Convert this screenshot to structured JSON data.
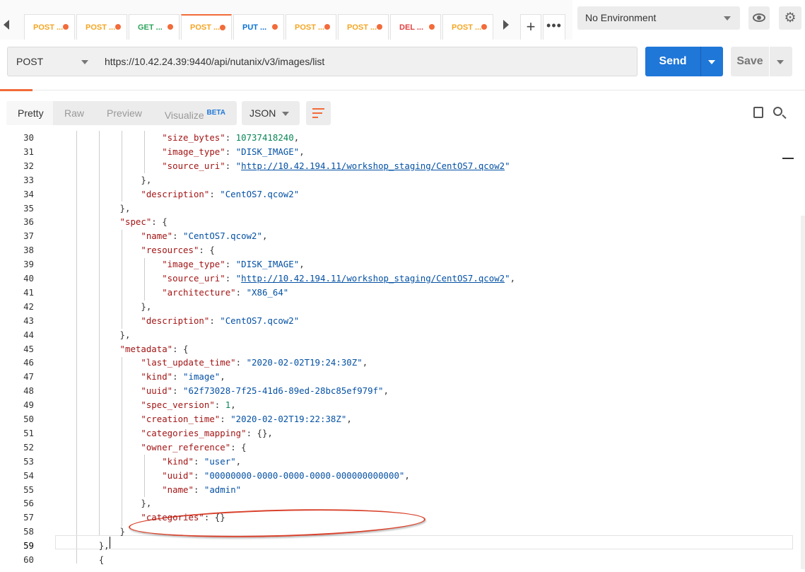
{
  "tabs": [
    {
      "method": "POST",
      "label": "POST ...",
      "kind": "post",
      "active": false
    },
    {
      "method": "POST",
      "label": "POST ...",
      "kind": "post",
      "active": false
    },
    {
      "method": "GET",
      "label": "GET ...",
      "kind": "get",
      "active": false
    },
    {
      "method": "POST",
      "label": "POST ...",
      "kind": "post",
      "active": true
    },
    {
      "method": "PUT",
      "label": "PUT ...",
      "kind": "put",
      "active": false
    },
    {
      "method": "POST",
      "label": "POST ...",
      "kind": "post",
      "active": false
    },
    {
      "method": "POST",
      "label": "POST ...",
      "kind": "post",
      "active": false
    },
    {
      "method": "DEL",
      "label": "DEL ...",
      "kind": "del",
      "active": false
    },
    {
      "method": "POST",
      "label": "POST ...",
      "kind": "post",
      "active": false
    }
  ],
  "header": {
    "add_tab": "+",
    "more": "•••",
    "environment": "No Environment"
  },
  "request": {
    "method": "POST",
    "url": "https://10.42.24.39:9440/api/nutanix/v3/images/list",
    "send_label": "Send",
    "save_label": "Save"
  },
  "response_toolbar": {
    "views": [
      "Pretty",
      "Raw",
      "Preview",
      "Visualize"
    ],
    "beta": "BETA",
    "format": "JSON"
  },
  "editor": {
    "current_line": 59,
    "lines": [
      {
        "n": 30,
        "indent": 5,
        "tokens": [
          [
            "k",
            "\"size_bytes\""
          ],
          [
            "p",
            ": "
          ],
          [
            "n",
            "10737418240"
          ],
          [
            "p",
            ","
          ]
        ]
      },
      {
        "n": 31,
        "indent": 5,
        "tokens": [
          [
            "k",
            "\"image_type\""
          ],
          [
            "p",
            ": "
          ],
          [
            "s",
            "\"DISK_IMAGE\""
          ],
          [
            "p",
            ","
          ]
        ]
      },
      {
        "n": 32,
        "indent": 5,
        "tokens": [
          [
            "k",
            "\"source_uri\""
          ],
          [
            "p",
            ": "
          ],
          [
            "s",
            "\""
          ],
          [
            "u",
            "http://10.42.194.11/workshop_staging/CentOS7.qcow2"
          ],
          [
            "s",
            "\""
          ]
        ]
      },
      {
        "n": 33,
        "indent": 4,
        "tokens": [
          [
            "p",
            "},"
          ]
        ]
      },
      {
        "n": 34,
        "indent": 4,
        "tokens": [
          [
            "k",
            "\"description\""
          ],
          [
            "p",
            ": "
          ],
          [
            "s",
            "\"CentOS7.qcow2\""
          ]
        ]
      },
      {
        "n": 35,
        "indent": 3,
        "tokens": [
          [
            "p",
            "},"
          ]
        ]
      },
      {
        "n": 36,
        "indent": 3,
        "tokens": [
          [
            "k",
            "\"spec\""
          ],
          [
            "p",
            ": {"
          ]
        ]
      },
      {
        "n": 37,
        "indent": 4,
        "tokens": [
          [
            "k",
            "\"name\""
          ],
          [
            "p",
            ": "
          ],
          [
            "s",
            "\"CentOS7.qcow2\""
          ],
          [
            "p",
            ","
          ]
        ]
      },
      {
        "n": 38,
        "indent": 4,
        "tokens": [
          [
            "k",
            "\"resources\""
          ],
          [
            "p",
            ": {"
          ]
        ]
      },
      {
        "n": 39,
        "indent": 5,
        "tokens": [
          [
            "k",
            "\"image_type\""
          ],
          [
            "p",
            ": "
          ],
          [
            "s",
            "\"DISK_IMAGE\""
          ],
          [
            "p",
            ","
          ]
        ]
      },
      {
        "n": 40,
        "indent": 5,
        "tokens": [
          [
            "k",
            "\"source_uri\""
          ],
          [
            "p",
            ": "
          ],
          [
            "s",
            "\""
          ],
          [
            "u",
            "http://10.42.194.11/workshop_staging/CentOS7.qcow2"
          ],
          [
            "s",
            "\""
          ],
          [
            "p",
            ","
          ]
        ]
      },
      {
        "n": 41,
        "indent": 5,
        "tokens": [
          [
            "k",
            "\"architecture\""
          ],
          [
            "p",
            ": "
          ],
          [
            "s",
            "\"X86_64\""
          ]
        ]
      },
      {
        "n": 42,
        "indent": 4,
        "tokens": [
          [
            "p",
            "},"
          ]
        ]
      },
      {
        "n": 43,
        "indent": 4,
        "tokens": [
          [
            "k",
            "\"description\""
          ],
          [
            "p",
            ": "
          ],
          [
            "s",
            "\"CentOS7.qcow2\""
          ]
        ]
      },
      {
        "n": 44,
        "indent": 3,
        "tokens": [
          [
            "p",
            "},"
          ]
        ]
      },
      {
        "n": 45,
        "indent": 3,
        "tokens": [
          [
            "k",
            "\"metadata\""
          ],
          [
            "p",
            ": {"
          ]
        ]
      },
      {
        "n": 46,
        "indent": 4,
        "tokens": [
          [
            "k",
            "\"last_update_time\""
          ],
          [
            "p",
            ": "
          ],
          [
            "s",
            "\"2020-02-02T19:24:30Z\""
          ],
          [
            "p",
            ","
          ]
        ]
      },
      {
        "n": 47,
        "indent": 4,
        "tokens": [
          [
            "k",
            "\"kind\""
          ],
          [
            "p",
            ": "
          ],
          [
            "s",
            "\"image\""
          ],
          [
            "p",
            ","
          ]
        ]
      },
      {
        "n": 48,
        "indent": 4,
        "tokens": [
          [
            "k",
            "\"uuid\""
          ],
          [
            "p",
            ": "
          ],
          [
            "s",
            "\"62f73028-7f25-41d6-89ed-28bc85ef979f\""
          ],
          [
            "p",
            ","
          ]
        ]
      },
      {
        "n": 49,
        "indent": 4,
        "tokens": [
          [
            "k",
            "\"spec_version\""
          ],
          [
            "p",
            ": "
          ],
          [
            "n",
            "1"
          ],
          [
            "p",
            ","
          ]
        ]
      },
      {
        "n": 50,
        "indent": 4,
        "tokens": [
          [
            "k",
            "\"creation_time\""
          ],
          [
            "p",
            ": "
          ],
          [
            "s",
            "\"2020-02-02T19:22:38Z\""
          ],
          [
            "p",
            ","
          ]
        ]
      },
      {
        "n": 51,
        "indent": 4,
        "tokens": [
          [
            "k",
            "\"categories_mapping\""
          ],
          [
            "p",
            ": {},"
          ]
        ]
      },
      {
        "n": 52,
        "indent": 4,
        "tokens": [
          [
            "k",
            "\"owner_reference\""
          ],
          [
            "p",
            ": {"
          ]
        ]
      },
      {
        "n": 53,
        "indent": 5,
        "tokens": [
          [
            "k",
            "\"kind\""
          ],
          [
            "p",
            ": "
          ],
          [
            "s",
            "\"user\""
          ],
          [
            "p",
            ","
          ]
        ]
      },
      {
        "n": 54,
        "indent": 5,
        "tokens": [
          [
            "k",
            "\"uuid\""
          ],
          [
            "p",
            ": "
          ],
          [
            "s",
            "\"00000000-0000-0000-0000-000000000000\""
          ],
          [
            "p",
            ","
          ]
        ]
      },
      {
        "n": 55,
        "indent": 5,
        "tokens": [
          [
            "k",
            "\"name\""
          ],
          [
            "p",
            ": "
          ],
          [
            "s",
            "\"admin\""
          ]
        ]
      },
      {
        "n": 56,
        "indent": 4,
        "tokens": [
          [
            "p",
            "},"
          ]
        ]
      },
      {
        "n": 57,
        "indent": 4,
        "tokens": [
          [
            "k",
            "\"categories\""
          ],
          [
            "p",
            ": {}"
          ]
        ]
      },
      {
        "n": 58,
        "indent": 3,
        "tokens": [
          [
            "p",
            "}"
          ]
        ]
      },
      {
        "n": 59,
        "indent": 2,
        "tokens": [
          [
            "p",
            "},"
          ]
        ]
      },
      {
        "n": 60,
        "indent": 2,
        "tokens": [
          [
            "p",
            "{"
          ]
        ]
      }
    ]
  },
  "colors": {
    "accent": "#f26b3a",
    "send": "#1f77d8",
    "post": "#f5a623",
    "get": "#2ca35b",
    "put": "#0a72d6",
    "del": "#e04040",
    "annotation": "#d9412b"
  }
}
